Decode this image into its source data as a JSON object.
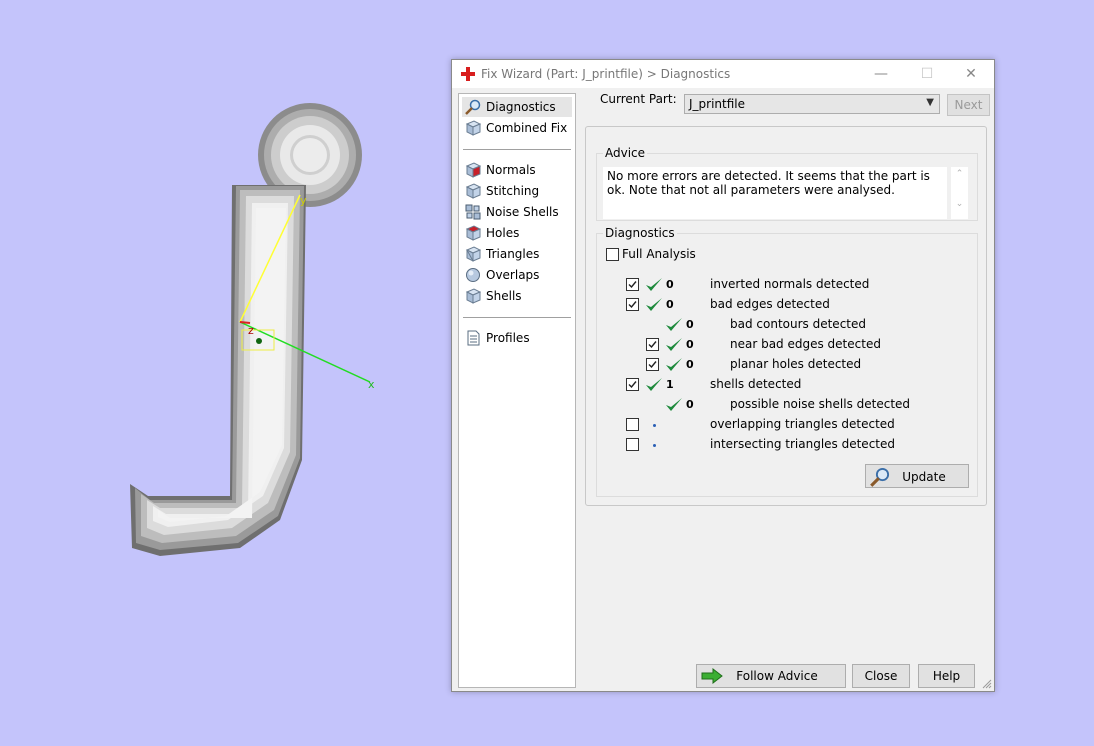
{
  "viewport": {
    "axes": {
      "y_label": "y",
      "x_label": "x",
      "z_label": "z"
    }
  },
  "window": {
    "title": "Fix Wizard (Part: J_printfile) > Diagnostics",
    "minimize": "—",
    "maximize": "☐",
    "close": "✕"
  },
  "nav": {
    "items": [
      {
        "label": "Diagnostics",
        "icon": "magnifier-icon",
        "selected": true
      },
      {
        "label": "Combined Fix",
        "icon": "cube-icon"
      },
      {
        "label": "Normals",
        "icon": "normals-cube-icon"
      },
      {
        "label": "Stitching",
        "icon": "stitching-cube-icon"
      },
      {
        "label": "Noise Shells",
        "icon": "noise-shells-icon"
      },
      {
        "label": "Holes",
        "icon": "holes-cube-icon"
      },
      {
        "label": "Triangles",
        "icon": "triangles-icon"
      },
      {
        "label": "Overlaps",
        "icon": "overlaps-icon"
      },
      {
        "label": "Shells",
        "icon": "shells-cube-icon"
      },
      {
        "label": "Profiles",
        "icon": "document-icon"
      }
    ]
  },
  "part": {
    "label": "Current Part:",
    "value": "J_printfile"
  },
  "next_label": "Next",
  "advice": {
    "title": "Advice",
    "text": "No more errors are detected. It seems that the part is ok. Note that not all parameters were analysed.",
    "scroll_up": "⌃",
    "scroll_down": "⌄"
  },
  "diagnostics": {
    "title": "Diagnostics",
    "full_analysis_label": "Full Analysis",
    "full_analysis_checked": false,
    "rows": [
      {
        "label": "inverted normals detected",
        "count": "0",
        "checked": true,
        "status": "ok",
        "indent": 0
      },
      {
        "label": "bad edges detected",
        "count": "0",
        "checked": true,
        "status": "ok",
        "indent": 0
      },
      {
        "label": "bad contours detected",
        "count": "0",
        "checkbox": false,
        "status": "ok",
        "indent": 1
      },
      {
        "label": "near bad edges detected",
        "count": "0",
        "checked": true,
        "status": "ok",
        "indent": 1
      },
      {
        "label": "planar holes detected",
        "count": "0",
        "checked": true,
        "status": "ok",
        "indent": 1
      },
      {
        "label": "shells detected",
        "count": "1",
        "checked": true,
        "status": "ok",
        "indent": 0
      },
      {
        "label": "possible noise shells detected",
        "count": "0",
        "checkbox": false,
        "status": "ok",
        "indent": 1
      },
      {
        "label": "overlapping triangles detected",
        "count": "",
        "checked": false,
        "status": "pending",
        "indent": 0
      },
      {
        "label": "intersecting triangles detected",
        "count": "",
        "checked": false,
        "status": "pending",
        "indent": 0
      }
    ],
    "update_label": "Update"
  },
  "footer": {
    "follow_advice_label": "Follow Advice",
    "close_label": "Close",
    "help_label": "Help"
  },
  "colors": {
    "background": "#c4c4fb",
    "ok_check": "#1e8a3c",
    "arrow_green": "#3cae33",
    "axis_y": "#ffff00",
    "axis_x": "#22dd22"
  }
}
